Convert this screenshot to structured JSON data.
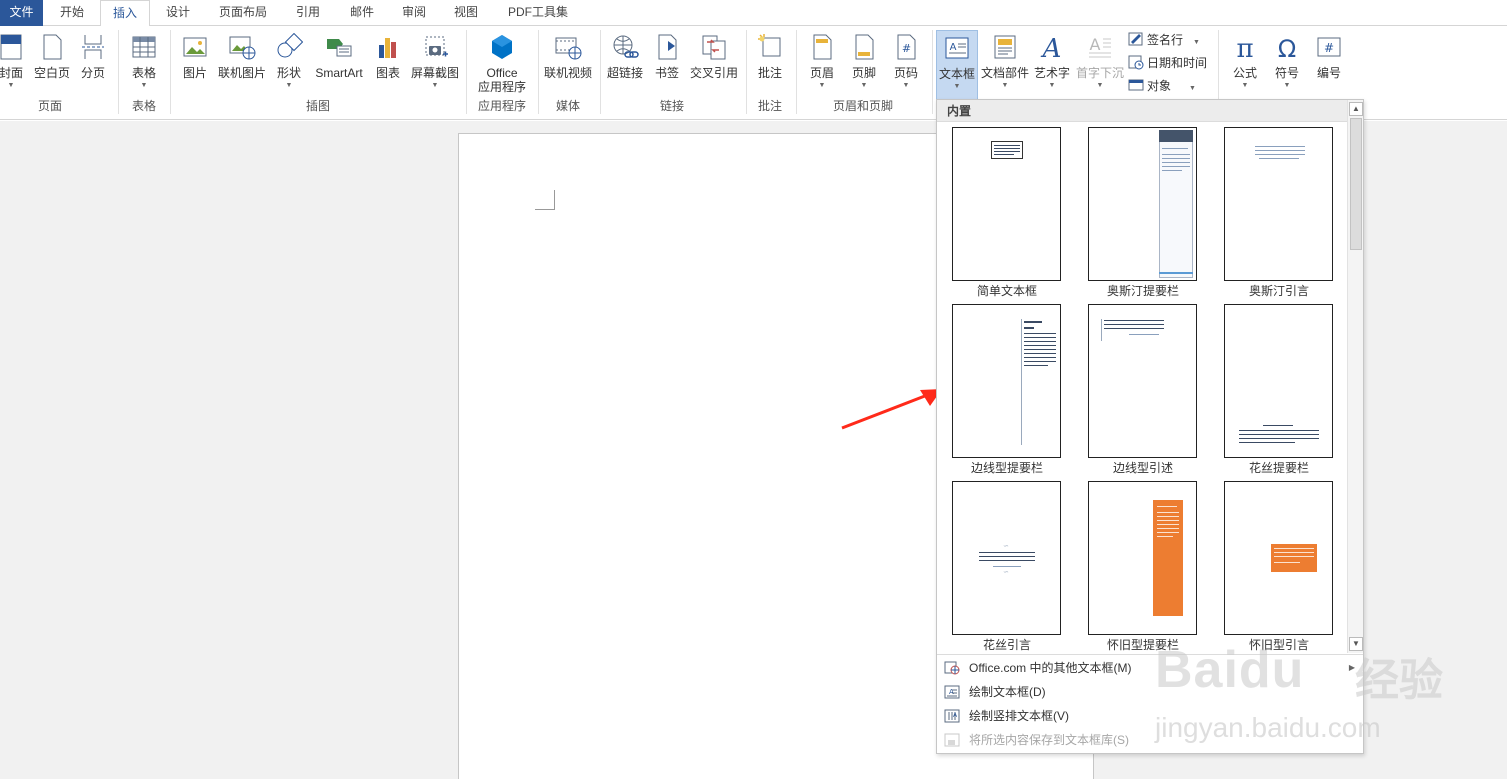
{
  "tabs": [
    "文件",
    "开始",
    "插入",
    "设计",
    "页面布局",
    "引用",
    "邮件",
    "审阅",
    "视图",
    "PDF工具集"
  ],
  "active_tab": "插入",
  "ribbon": {
    "page_group": {
      "label": "页面",
      "cover": "封面",
      "blank": "空白页",
      "break": "分页"
    },
    "table_group": {
      "label": "表格",
      "table": "表格"
    },
    "illus_group": {
      "label": "插图",
      "picture": "图片",
      "online_picture": "联机图片",
      "shapes": "形状",
      "smartart": "SmartArt",
      "chart": "图表",
      "screenshot": "屏幕截图"
    },
    "apps_group": {
      "label": "应用程序",
      "office_line1": "Office",
      "office_line2": "应用程序"
    },
    "media_group": {
      "label": "媒体",
      "online_video": "联机视频"
    },
    "links_group": {
      "label": "链接",
      "hyperlink": "超链接",
      "bookmark": "书签",
      "cross_ref": "交叉引用"
    },
    "comments_group": {
      "label": "批注",
      "comment": "批注"
    },
    "hf_group": {
      "label": "页眉和页脚",
      "header": "页眉",
      "footer": "页脚",
      "page_number": "页码"
    },
    "text_group": {
      "textbox": "文本框",
      "quick_parts": "文档部件",
      "wordart": "艺术字",
      "dropcap": "首字下沉",
      "signature": "签名行",
      "datetime": "日期和时间",
      "object": "对象"
    },
    "symbols_group": {
      "equation": "公式",
      "symbol": "符号",
      "number": "编号"
    }
  },
  "gallery": {
    "section": "内置",
    "items": [
      "简单文本框",
      "奥斯汀提要栏",
      "奥斯汀引言",
      "边线型提要栏",
      "边线型引述",
      "花丝提要栏",
      "花丝引言",
      "怀旧型提要栏",
      "怀旧型引言"
    ],
    "menu": [
      {
        "label": "Office.com 中的其他文本框(M)",
        "enabled": true
      },
      {
        "label": "绘制文本框(D)",
        "enabled": true
      },
      {
        "label": "绘制竖排文本框(V)",
        "enabled": true
      },
      {
        "label": "将所选内容保存到文本框库(S)",
        "enabled": false
      }
    ]
  },
  "watermark": {
    "brand": "Baidu",
    "cn": "经验",
    "url": "jingyan.baidu.com"
  },
  "colors": {
    "accent": "#2b579a",
    "selected": "#c5d9f1",
    "arrow": "#ff2a1a",
    "orange": "#ed7d31"
  }
}
